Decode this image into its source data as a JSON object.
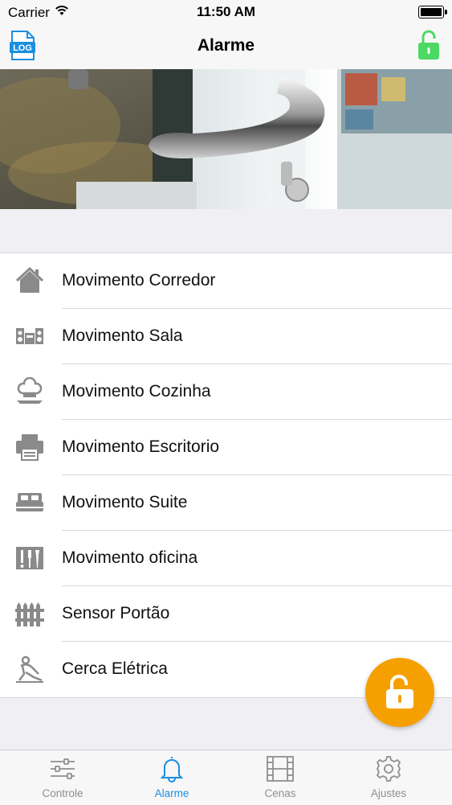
{
  "status_bar": {
    "carrier": "Carrier",
    "time": "11:50 AM"
  },
  "nav": {
    "title": "Alarme",
    "log_icon_text": "LOG"
  },
  "sensors": [
    {
      "label": "Movimento Corredor",
      "icon": "house-icon"
    },
    {
      "label": "Movimento Sala",
      "icon": "stereo-icon"
    },
    {
      "label": "Movimento Cozinha",
      "icon": "chef-hat-icon"
    },
    {
      "label": "Movimento Escritorio",
      "icon": "printer-icon"
    },
    {
      "label": "Movimento Suite",
      "icon": "bed-icon"
    },
    {
      "label": "Movimento oficina",
      "icon": "tools-icon"
    },
    {
      "label": "Sensor Portão",
      "icon": "fence-icon"
    },
    {
      "label": "Cerca Elétrica",
      "icon": "climber-icon"
    }
  ],
  "tabs": [
    {
      "label": "Controle",
      "icon": "sliders-icon",
      "active": false
    },
    {
      "label": "Alarme",
      "icon": "bell-icon",
      "active": true
    },
    {
      "label": "Cenas",
      "icon": "film-icon",
      "active": false
    },
    {
      "label": "Ajustes",
      "icon": "gear-icon",
      "active": false
    }
  ],
  "colors": {
    "accent": "#1a8fe0",
    "lock_green": "#4cd964",
    "fab_orange": "#f5a000",
    "icon_gray": "#8a8a8a"
  }
}
